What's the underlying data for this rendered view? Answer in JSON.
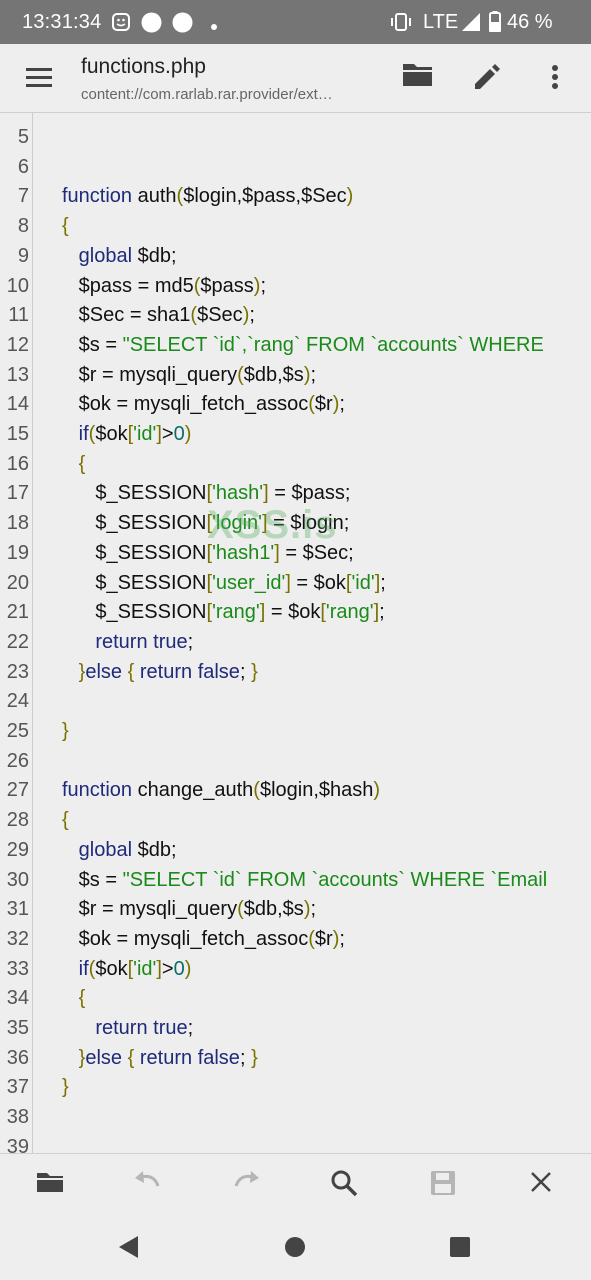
{
  "status_bar": {
    "time": "13:31:34",
    "network": "LTE",
    "battery": "46 %",
    "icons": [
      "face-notification-icon",
      "circle-notification-icon",
      "circle-notification-icon",
      "dot-icon",
      "vibrate-icon",
      "signal-icon",
      "battery-icon"
    ]
  },
  "app_bar": {
    "title": "functions.php",
    "subtitle": "content://com.rarlab.rar.provider/ext…",
    "icons": [
      "menu-icon",
      "folder-open-icon",
      "edit-icon",
      "more-vert-icon"
    ]
  },
  "editor": {
    "watermark": "XSS.is",
    "lines": [
      {
        "n": "5",
        "code": ""
      },
      {
        "n": "6",
        "code": ""
      },
      {
        "n": "7",
        "code": "function auth($login,$pass,$Sec)"
      },
      {
        "n": "8",
        "code": "{"
      },
      {
        "n": "9",
        "code": "   global $db;"
      },
      {
        "n": "10",
        "code": "   $pass = md5($pass);"
      },
      {
        "n": "11",
        "code": "   $Sec = sha1($Sec);"
      },
      {
        "n": "12",
        "code": "   $s = \"SELECT `id`,`rang` FROM `accounts` WHERE"
      },
      {
        "n": "13",
        "code": "   $r = mysqli_query($db,$s);"
      },
      {
        "n": "14",
        "code": "   $ok = mysqli_fetch_assoc($r);"
      },
      {
        "n": "15",
        "code": "   if($ok['id']>0)"
      },
      {
        "n": "16",
        "code": "   {"
      },
      {
        "n": "17",
        "code": "      $_SESSION['hash'] = $pass;"
      },
      {
        "n": "18",
        "code": "      $_SESSION['login'] = $login;"
      },
      {
        "n": "19",
        "code": "      $_SESSION['hash1'] = $Sec;"
      },
      {
        "n": "20",
        "code": "      $_SESSION['user_id'] = $ok['id'];"
      },
      {
        "n": "21",
        "code": "      $_SESSION['rang'] = $ok['rang'];"
      },
      {
        "n": "22",
        "code": "      return true;"
      },
      {
        "n": "23",
        "code": "   }else { return false; }"
      },
      {
        "n": "24",
        "code": ""
      },
      {
        "n": "25",
        "code": "}"
      },
      {
        "n": "26",
        "code": ""
      },
      {
        "n": "27",
        "code": "function change_auth($login,$hash)"
      },
      {
        "n": "28",
        "code": "{"
      },
      {
        "n": "29",
        "code": "   global $db;"
      },
      {
        "n": "30",
        "code": "   $s = \"SELECT `id` FROM `accounts` WHERE `Email"
      },
      {
        "n": "31",
        "code": "   $r = mysqli_query($db,$s);"
      },
      {
        "n": "32",
        "code": "   $ok = mysqli_fetch_assoc($r);"
      },
      {
        "n": "33",
        "code": "   if($ok['id']>0)"
      },
      {
        "n": "34",
        "code": "   {"
      },
      {
        "n": "35",
        "code": "      return true;"
      },
      {
        "n": "36",
        "code": "   }else { return false; }"
      },
      {
        "n": "37",
        "code": "}"
      },
      {
        "n": "38",
        "code": ""
      },
      {
        "n": "39",
        "code": ""
      }
    ]
  },
  "toolbar": {
    "icons": [
      "open-folder-icon",
      "undo-icon",
      "redo-icon",
      "search-icon",
      "save-icon",
      "close-icon"
    ]
  },
  "nav_bar": {
    "icons": [
      "back-icon",
      "home-icon",
      "recents-icon"
    ]
  },
  "colors": {
    "keyword": "#1f2a7a",
    "string": "#1a8a1a",
    "number": "#0b6d6d",
    "paren": "#7a7200",
    "status_bar_bg": "#757575",
    "background": "#eeeeee"
  }
}
